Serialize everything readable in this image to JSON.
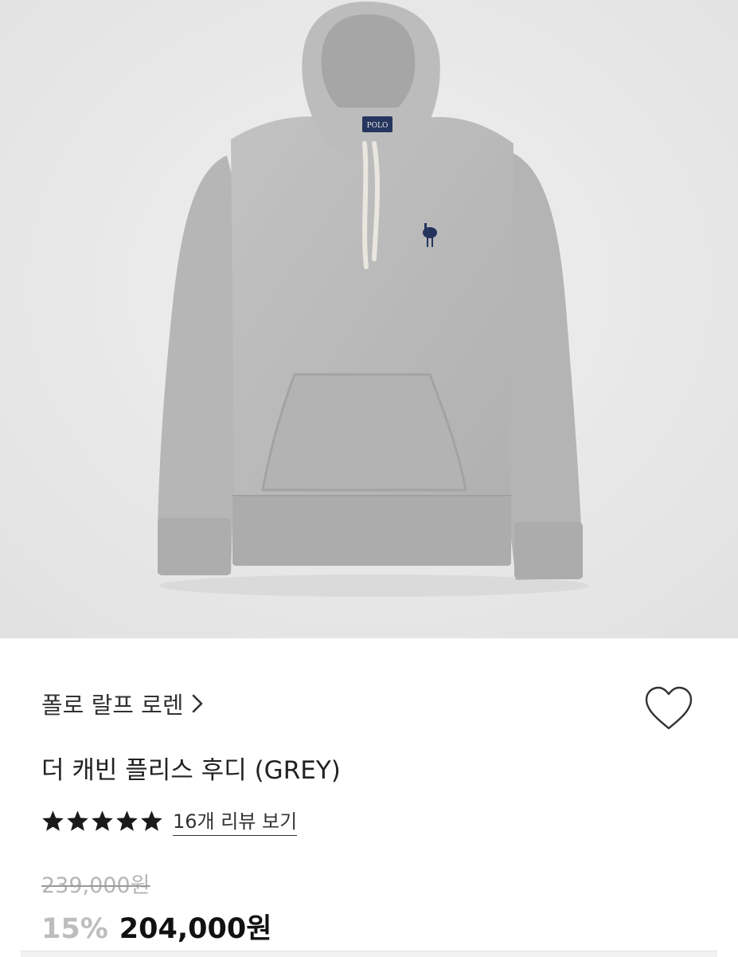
{
  "product": {
    "brand": "폴로 랄프 로렌",
    "name": "더 캐빈 플리스 후디 (GREY)",
    "rating": 5,
    "rating_max": 5,
    "review_link": "16개 리뷰 보기",
    "original_price": "239,000원",
    "discount": "15%",
    "sale_price": "204,000원",
    "image_logo_text": "POLO"
  },
  "icons": {
    "brand_chevron": "chevron-right-icon",
    "wishlist": "heart-outline-icon",
    "star": "star-icon"
  },
  "colors": {
    "image_background": "#ebebeb",
    "hoodie": "#b9b9b9",
    "logo": "#24345c",
    "star": "#1a1a1a",
    "discount": "#bdbdbd",
    "original_price": "#b5b5b5"
  }
}
